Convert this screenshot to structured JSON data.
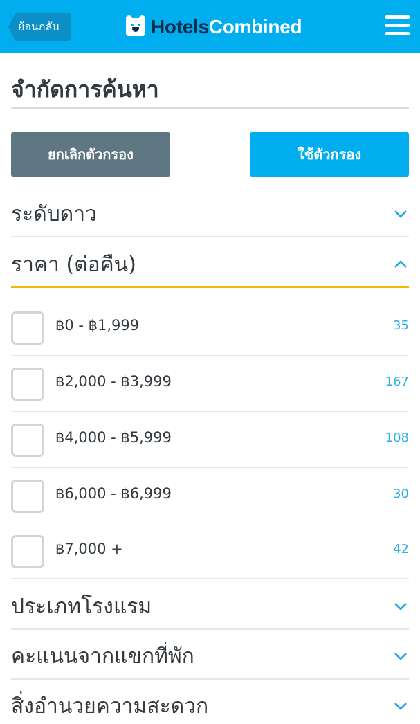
{
  "header": {
    "back_label": "ย้อนกลับ",
    "logo_part1": "Hotels",
    "logo_part2": "Combined",
    "menu_icon": "hamburger-icon"
  },
  "page_title": "จำกัดการค้นหา",
  "buttons": {
    "cancel_label": "ยกเลิกตัวกรอง",
    "apply_label": "ใช้ตัวกรอง"
  },
  "sections": [
    {
      "label": "ระดับดาว",
      "expanded": false
    },
    {
      "label": "ราคา (ต่อคืน)",
      "expanded": true
    },
    {
      "label": "ประเภทโรงแรม",
      "expanded": false
    },
    {
      "label": "คะแนนจากแขกที่พัก",
      "expanded": false
    },
    {
      "label": "สิ่งอำนวยความสะดวก",
      "expanded": false
    }
  ],
  "price_options": [
    {
      "label": "฿0 - ฿1,999",
      "count": "35",
      "checked": false
    },
    {
      "label": "฿2,000 - ฿3,999",
      "count": "167",
      "checked": false
    },
    {
      "label": "฿4,000 - ฿5,999",
      "count": "108",
      "checked": false
    },
    {
      "label": "฿6,000 - ฿6,999",
      "count": "30",
      "checked": false
    },
    {
      "label": "฿7,000 +",
      "count": "42",
      "checked": false
    }
  ],
  "colors": {
    "header_blue": "#00aef0",
    "accent_yellow": "#f2b705",
    "cancel_gray": "#5f7782",
    "count_blue": "#2fb0e6"
  }
}
